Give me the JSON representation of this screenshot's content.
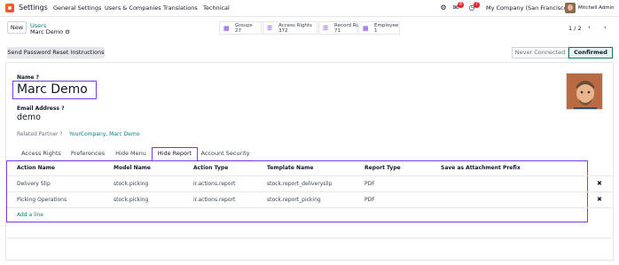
{
  "topbar": {
    "app_name": "Settings",
    "menu": [
      "General Settings",
      "Users & Companies",
      "Translations",
      "Technical"
    ],
    "chat_badge": "8",
    "activity_badge": "7",
    "company": "My Company (San Francisco)",
    "user": "Mitchell Admin"
  },
  "control": {
    "new_label": "New",
    "breadcrumb_parent": "Users",
    "breadcrumb_current": "Marc Demo ⚙",
    "pager": "1 / 2"
  },
  "stats": [
    {
      "label": "Groups",
      "value": "27"
    },
    {
      "label": "Access Rights",
      "value": "372"
    },
    {
      "label": "Record Rules",
      "value": "71"
    },
    {
      "label": "Employee",
      "value": "1"
    }
  ],
  "actions": {
    "reset_label": "Send Password Reset Instructions",
    "status_never": "Never Connected",
    "status_confirmed": "Confirmed"
  },
  "form": {
    "name_label": "Name ?",
    "name_value": "Marc Demo",
    "email_label": "Email Address ?",
    "email_value": "demo",
    "partner_label": "Related Partner ?",
    "partner_value": "YourCompany, Marc Demo"
  },
  "tabs": [
    "Access Rights",
    "Preferences",
    "Hide Menu",
    "Hide Report",
    "Account Security"
  ],
  "active_tab": "Hide Report",
  "table": {
    "columns": [
      "Action Name",
      "Model Name",
      "Action Type",
      "Template Name",
      "Report Type",
      "Save as Attachment Prefix"
    ],
    "rows": [
      [
        "Delivery Slip",
        "stock.picking",
        "ir.actions.report",
        "stock.report_deliveryslip",
        "PDF",
        ""
      ],
      [
        "Picking Operations",
        "stock.picking",
        "ir.actions.report",
        "stock.report_picking",
        "PDF",
        ""
      ]
    ],
    "add_line": "Add a line"
  },
  "colors": {
    "accent": "#7c3aed",
    "link": "#017e84"
  }
}
